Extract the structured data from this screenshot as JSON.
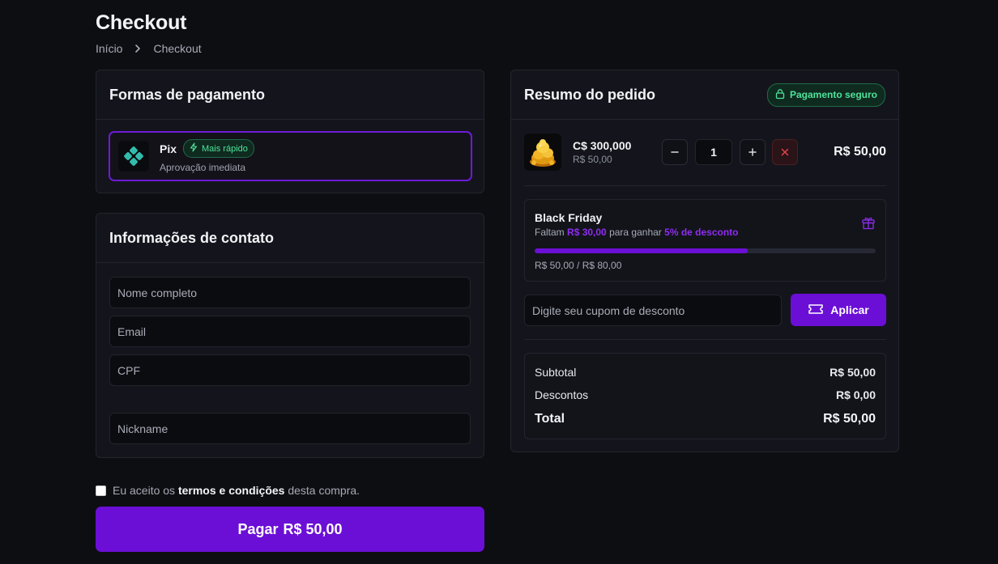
{
  "page": {
    "title": "Checkout",
    "breadcrumb": [
      "Início",
      "Checkout"
    ]
  },
  "payment": {
    "title": "Formas de pagamento",
    "method": {
      "name": "Pix",
      "badge": "Mais rápido",
      "description": "Aprovação imediata",
      "selected": true
    }
  },
  "contact": {
    "title": "Informações de contato",
    "fields": {
      "name_placeholder": "Nome completo",
      "email_placeholder": "Email",
      "cpf_placeholder": "CPF",
      "nickname_placeholder": "Nickname"
    }
  },
  "terms": {
    "prefix": "Eu aceito os",
    "link": "termos e condições",
    "suffix": "desta compra.",
    "checked": false
  },
  "pay_button": {
    "label": "Pagar",
    "amount": "R$ 50,00"
  },
  "summary": {
    "title": "Resumo do pedido",
    "secure_badge": "Pagamento seguro",
    "item": {
      "name": "C$ 300,000",
      "unit_price": "R$ 50,00",
      "quantity": "1",
      "total": "R$ 50,00",
      "icon": "gold-coins-icon"
    },
    "promo": {
      "title": "Black Friday",
      "desc_prefix": "Faltam",
      "desc_amount": "R$ 30,00",
      "desc_middle": "para ganhar",
      "desc_discount": "5% de desconto",
      "progress_text": "R$ 50,00 / R$ 80,00",
      "progress_fraction": 0.625
    },
    "coupon": {
      "placeholder": "Digite seu cupom de desconto",
      "apply_label": "Aplicar"
    },
    "totals": {
      "subtotal_label": "Subtotal",
      "subtotal_value": "R$ 50,00",
      "discount_label": "Descontos",
      "discount_value": "R$ 0,00",
      "total_label": "Total",
      "total_value": "R$ 50,00"
    }
  },
  "colors": {
    "accent": "#6b0fd6",
    "success": "#4ee39a",
    "danger": "#e0424e",
    "background": "#0d0e12",
    "card": "#14151c"
  }
}
